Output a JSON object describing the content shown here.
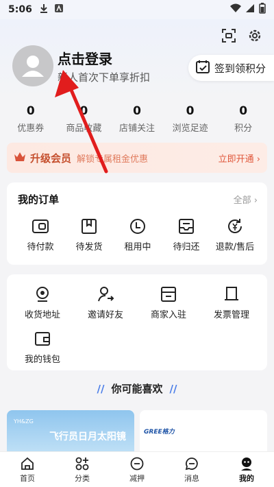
{
  "status": {
    "time": "5:06"
  },
  "header": {
    "login_title": "点击登录",
    "login_sub": "新人首次下单享折扣",
    "signin_label": "签到领积分"
  },
  "stats": [
    {
      "num": "0",
      "label": "优惠券"
    },
    {
      "num": "0",
      "label": "商品收藏"
    },
    {
      "num": "0",
      "label": "店铺关注"
    },
    {
      "num": "0",
      "label": "浏览足迹"
    },
    {
      "num": "0",
      "label": "积分"
    }
  ],
  "vip": {
    "title": "升级会员",
    "desc": "解锁专属租金优惠",
    "open": "立即开通"
  },
  "orders": {
    "title": "我的订单",
    "all": "全部",
    "items": [
      {
        "label": "待付款",
        "icon": "wallet-icon"
      },
      {
        "label": "待发货",
        "icon": "box-icon"
      },
      {
        "label": "租用中",
        "icon": "clock-icon"
      },
      {
        "label": "待归还",
        "icon": "tray-icon"
      },
      {
        "label": "退款/售后",
        "icon": "refund-icon"
      }
    ]
  },
  "tools": [
    {
      "label": "收货地址",
      "icon": "location-icon"
    },
    {
      "label": "邀请好友",
      "icon": "invite-icon"
    },
    {
      "label": "商家入驻",
      "icon": "store-icon"
    },
    {
      "label": "发票管理",
      "icon": "invoice-icon"
    },
    {
      "label": "我的钱包",
      "icon": "wallet-icon"
    }
  ],
  "guess_title": "你可能喜欢",
  "products": [
    {
      "brand": "YH&ZG",
      "title": "飞行员日月太阳镜"
    },
    {
      "brand": "GREE格力"
    }
  ],
  "tabs": [
    {
      "label": "首页",
      "icon": "home-icon"
    },
    {
      "label": "分类",
      "icon": "category-icon"
    },
    {
      "label": "减押",
      "icon": "deposit-icon"
    },
    {
      "label": "消息",
      "icon": "message-icon"
    },
    {
      "label": "我的",
      "icon": "profile-icon"
    }
  ],
  "colors": {
    "accent": "#e0573a",
    "vip_bg": "#fde9e2",
    "blue": "#4a7de8",
    "arrow": "#e11d1d"
  }
}
